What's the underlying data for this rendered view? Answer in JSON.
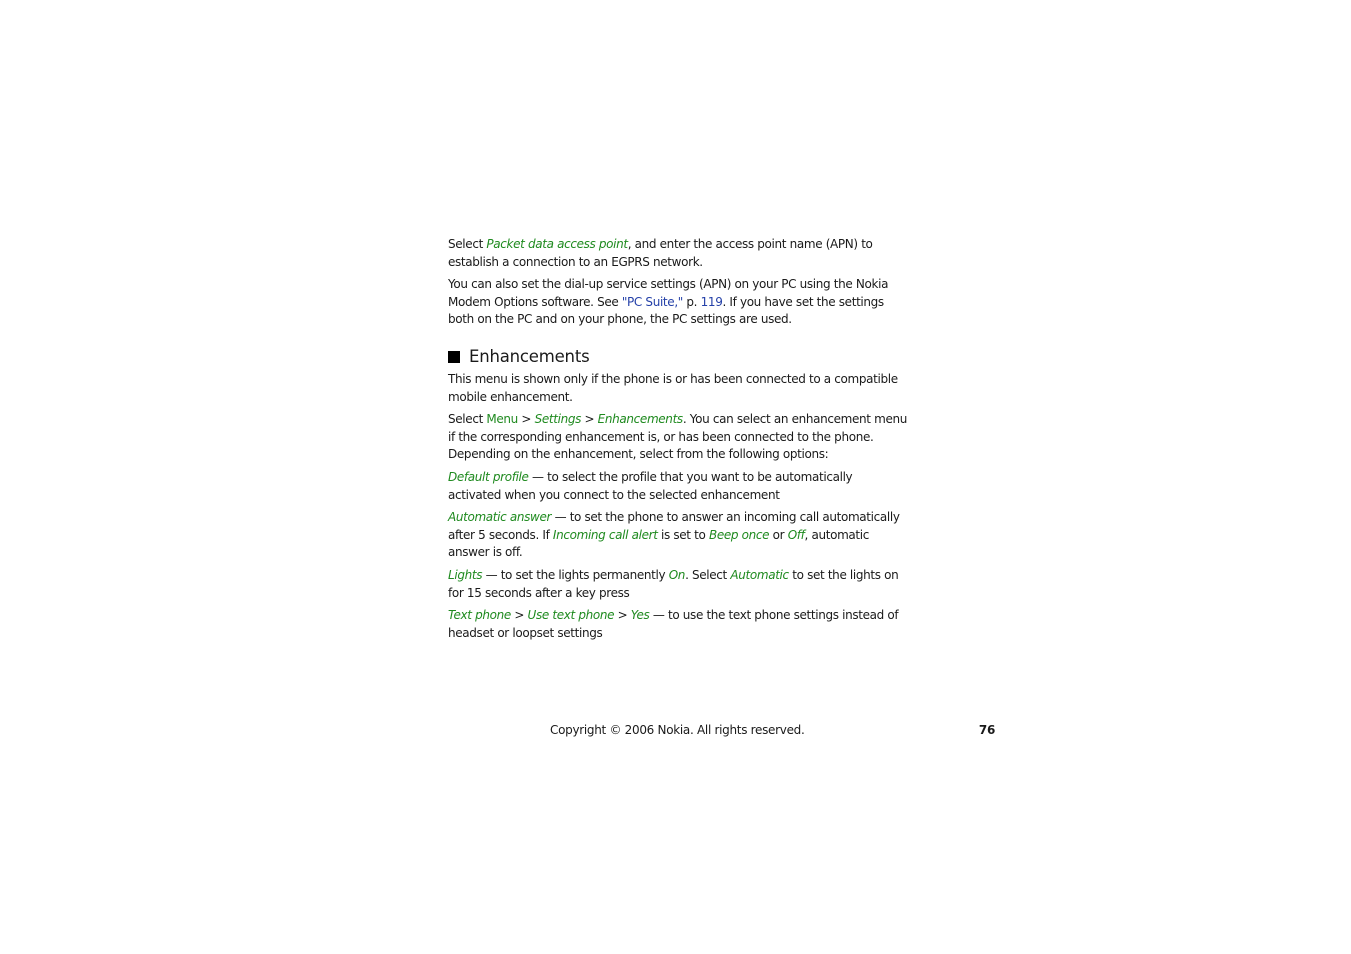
{
  "p1": {
    "a": "Select ",
    "link": "Packet data access point",
    "b": ", and enter the access point name (APN) to establish a connection to an EGPRS network."
  },
  "p2": {
    "a": "You can also set the dial-up service settings (APN) on your PC using the Nokia Modem Options software. See ",
    "ref": "\"PC Suite,\"",
    "b": " p. ",
    "page": "119",
    "c": ". If you have set the settings both on the PC and on your phone, the PC settings are used."
  },
  "heading": "Enhancements",
  "p3": "This menu is shown only if the phone is or has been connected to a compatible mobile enhancement.",
  "p4": {
    "a": "Select ",
    "menu": "Menu",
    "sep1": " > ",
    "settings": "Settings",
    "sep2": " > ",
    "enh": "Enhancements",
    "b": ". You can select an enhancement menu if the corresponding enhancement is, or has been connected to the phone. Depending on the enhancement, select from the following options:"
  },
  "opt1": {
    "term": "Default profile",
    "desc": " — to select the profile that you want to be automatically activated when you connect to the selected enhancement"
  },
  "opt2": {
    "term": "Automatic answer",
    "a": " — to set the phone to answer an incoming call automatically after 5 seconds. If ",
    "t2": "Incoming call alert",
    "b": " is set to ",
    "t3": "Beep once",
    "c": " or ",
    "t4": "Off",
    "d": ", automatic answer is off."
  },
  "opt3": {
    "term": "Lights",
    "a": " — to set the lights permanently ",
    "t2": "On",
    "b": ". Select ",
    "t3": "Automatic",
    "c": " to set the lights on for 15 seconds after a key press"
  },
  "opt4": {
    "term": "Text phone",
    "sep1": " > ",
    "t2": "Use text phone",
    "sep2": " > ",
    "t3": "Yes",
    "desc": " — to use the text phone settings instead of headset or loopset settings"
  },
  "footer": {
    "copyright": "Copyright © 2006 Nokia. All rights reserved.",
    "page_number": "76"
  }
}
